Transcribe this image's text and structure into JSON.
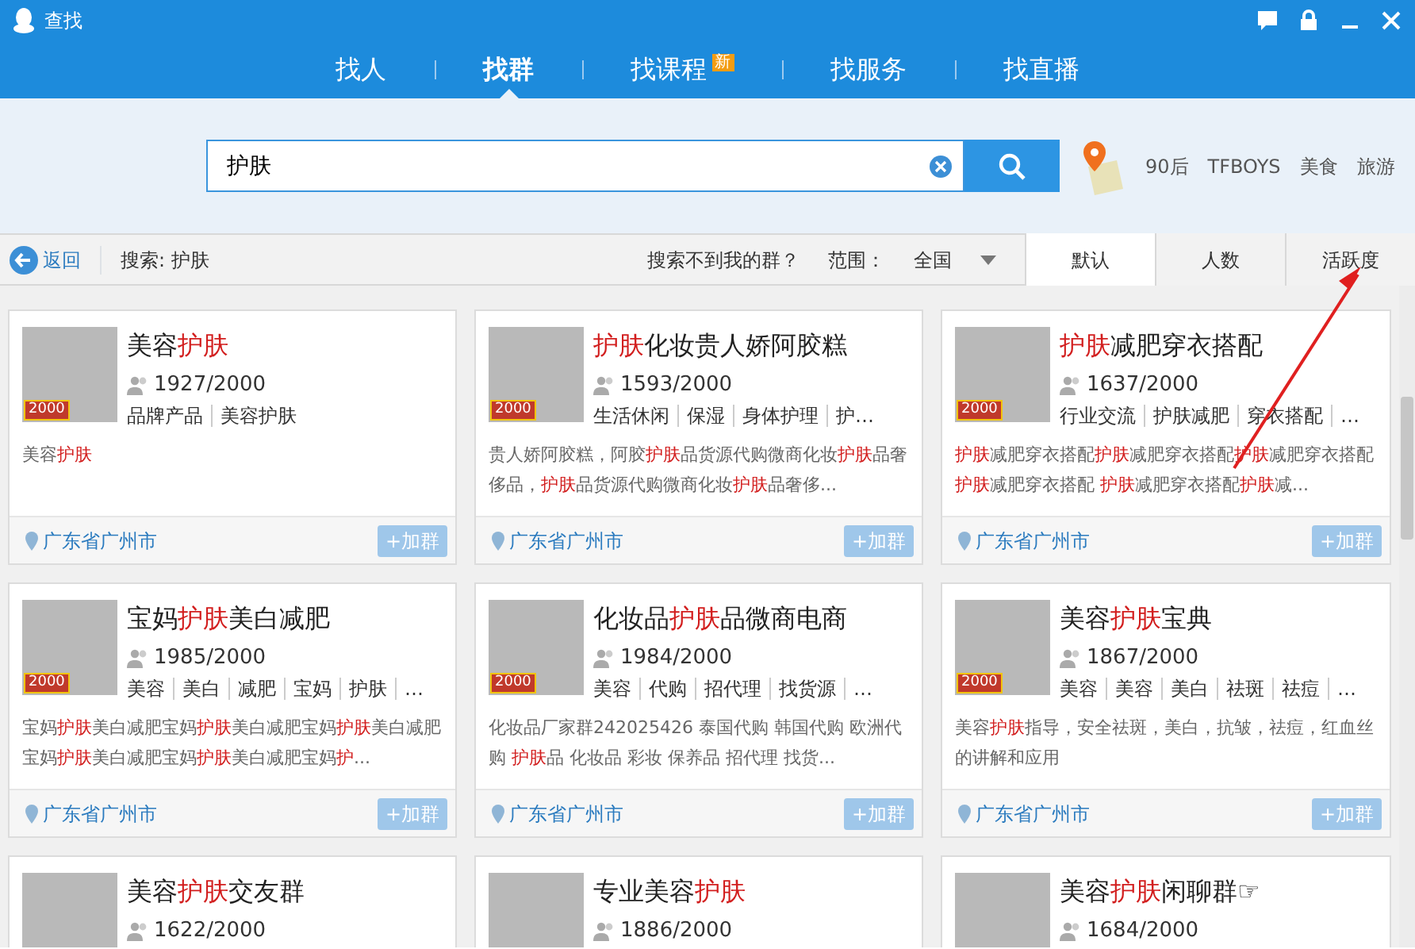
{
  "window": {
    "title": "查找"
  },
  "tabs": [
    {
      "label": "找人",
      "selected": false
    },
    {
      "label": "找群",
      "selected": true
    },
    {
      "label": "找课程",
      "selected": false,
      "badge": "新"
    },
    {
      "label": "找服务",
      "selected": false
    },
    {
      "label": "找直播",
      "selected": false
    }
  ],
  "search": {
    "value": "护肤",
    "hot_tags": [
      "90后",
      "TFBOYS",
      "美食",
      "旅游"
    ]
  },
  "toolbar": {
    "back": "返回",
    "query": "搜索: 护肤",
    "help_link": "搜索不到我的群？",
    "scope_label": "范围：",
    "scope_value": "全国",
    "sort_tabs": [
      {
        "label": "默认",
        "selected": true
      },
      {
        "label": "人数",
        "selected": false
      },
      {
        "label": "活跃度",
        "selected": false
      }
    ]
  },
  "groups": [
    {
      "title": "美容**护肤**",
      "badge": "2000",
      "members": "1927/2000",
      "tags": [
        "品牌产品",
        "美容护肤"
      ],
      "description": "美容**护肤**",
      "location": "广东省广州市",
      "join": "+加群"
    },
    {
      "title": "**护肤**化妆贵人娇阿胶糕",
      "badge": "2000",
      "members": "1593/2000",
      "tags": [
        "生活休闲",
        "保湿",
        "身体护理",
        "护…"
      ],
      "description": "贵人娇阿胶糕，阿胶**护肤**品货源代购微商化妆**护肤**品奢侈品，**护肤**品货源代购微商化妆**护肤**品奢侈...",
      "location": "广东省广州市",
      "join": "+加群"
    },
    {
      "title": "**护肤**减肥穿衣搭配",
      "badge": "2000",
      "members": "1637/2000",
      "tags": [
        "行业交流",
        "护肤减肥",
        "穿衣搭配",
        "…"
      ],
      "description": "**护肤**减肥穿衣搭配**护肤**减肥穿衣搭配**护肤**减肥穿衣搭配**护肤**减肥穿衣搭配 **护肤**减肥穿衣搭配**护肤**减...",
      "location": "广东省广州市",
      "join": "+加群"
    },
    {
      "title": "宝妈**护肤**美白减肥",
      "badge": "2000",
      "members": "1985/2000",
      "tags": [
        "美容",
        "美白",
        "减肥",
        "宝妈",
        "护肤",
        "…"
      ],
      "description": "宝妈**护肤**美白减肥宝妈**护肤**美白减肥宝妈**护肤**美白减肥宝妈**护肤**美白减肥宝妈**护肤**美白减肥宝妈**护**...",
      "location": "广东省广州市",
      "join": "+加群"
    },
    {
      "title": "化妆品**护肤**品微商电商",
      "badge": "2000",
      "members": "1984/2000",
      "tags": [
        "美容",
        "代购",
        "招代理",
        "找货源",
        "…"
      ],
      "description": "化妆品厂家群242025426 泰国代购 韩国代购 欧洲代购 **护肤**品 化妆品 彩妆 保养品 招代理 找货...",
      "location": "广东省广州市",
      "join": "+加群"
    },
    {
      "title": "美容**护肤**宝典",
      "badge": "2000",
      "members": "1867/2000",
      "tags": [
        "美容",
        "美容",
        "美白",
        "祛斑",
        "祛痘",
        "…"
      ],
      "description": "美容**护肤**指导，安全祛斑，美白，抗皱，祛痘，红血丝的讲解和应用",
      "location": "广东省广州市",
      "join": "+加群"
    },
    {
      "title": "美容**护肤**交友群",
      "members": "1622/2000"
    },
    {
      "title": "专业美容**护肤**",
      "members": "1886/2000"
    },
    {
      "title": "美容**护肤**闲聊群☞",
      "members": "1684/2000"
    }
  ]
}
